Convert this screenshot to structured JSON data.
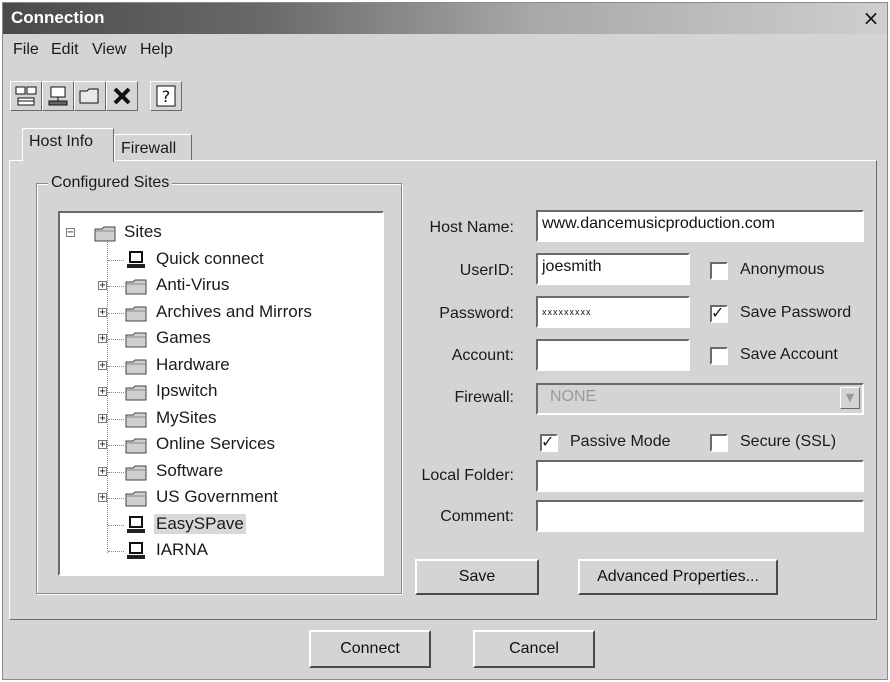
{
  "window": {
    "title": "Connection",
    "close_glyph": "×"
  },
  "menu": [
    "File",
    "Edit",
    "View",
    "Help"
  ],
  "toolbar": {
    "buttons": [
      "new-site-icon",
      "new-connection-icon",
      "new-folder-icon",
      "delete-icon",
      "help-icon"
    ]
  },
  "tabs": [
    {
      "label": "Host Info",
      "active": true
    },
    {
      "label": "Firewall",
      "active": false
    }
  ],
  "configured_sites": {
    "label": "Configured Sites",
    "tree": [
      {
        "label": "Sites",
        "type": "folder",
        "expander": "−"
      },
      {
        "label": "Quick connect",
        "type": "computer"
      },
      {
        "label": "Anti-Virus",
        "type": "folder",
        "expander": "+"
      },
      {
        "label": "Archives and Mirrors",
        "type": "folder",
        "expander": "+"
      },
      {
        "label": "Games",
        "type": "folder",
        "expander": "+"
      },
      {
        "label": "Hardware",
        "type": "folder",
        "expander": "+"
      },
      {
        "label": "Ipswitch",
        "type": "folder",
        "expander": "+"
      },
      {
        "label": "MySites",
        "type": "folder",
        "expander": "+"
      },
      {
        "label": "Online Services",
        "type": "folder",
        "expander": "+"
      },
      {
        "label": "Software",
        "type": "folder",
        "expander": "+"
      },
      {
        "label": "US Government",
        "type": "folder",
        "expander": "+"
      },
      {
        "label": "EasySPave",
        "type": "computer",
        "selected": true
      },
      {
        "label": "IARNA",
        "type": "computer"
      }
    ]
  },
  "form": {
    "host_name_label": "Host Name:",
    "host_name_value": "www.dancemusicproduction.com",
    "userid_label": "UserID:",
    "userid_value": "joesmith",
    "password_label": "Password:",
    "password_value": "xxxxxxxxx",
    "account_label": "Account:",
    "account_value": "",
    "firewall_label": "Firewall:",
    "firewall_value": "NONE",
    "local_folder_label": "Local Folder:",
    "local_folder_value": "",
    "comment_label": "Comment:",
    "comment_value": "",
    "anonymous_label": "Anonymous",
    "anonymous_checked": false,
    "save_password_label": "Save Password",
    "save_password_checked": true,
    "save_account_label": "Save Account",
    "save_account_checked": false,
    "passive_mode_label": "Passive Mode",
    "passive_mode_checked": true,
    "secure_ssl_label": "Secure (SSL)",
    "secure_ssl_checked": false,
    "check_glyph": "✓",
    "dropdown_glyph": "▼",
    "save_button": "Save",
    "advanced_button": "Advanced Properties..."
  },
  "footer": {
    "connect_button": "Connect",
    "cancel_button": "Cancel"
  }
}
